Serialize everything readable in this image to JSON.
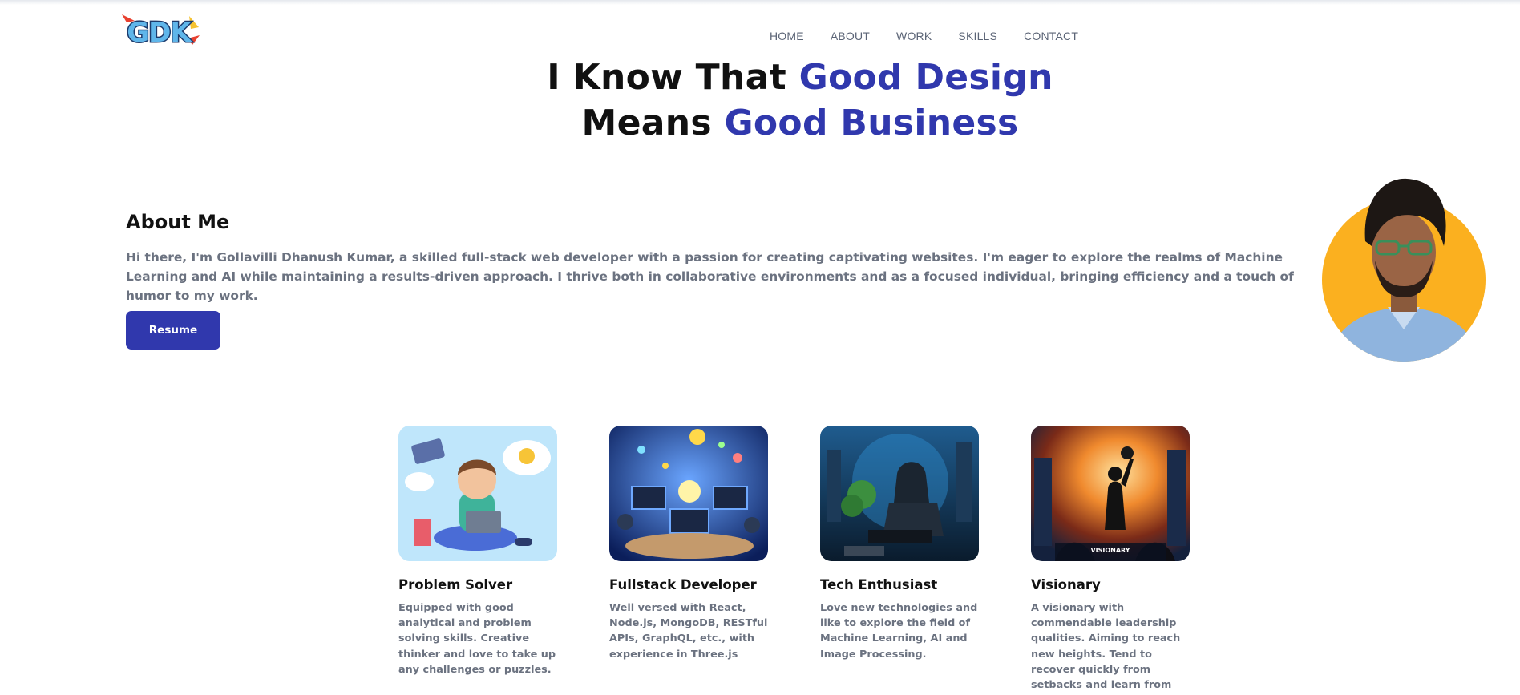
{
  "brand": {
    "logo_text": "GDK"
  },
  "nav": {
    "items": [
      {
        "label": "HOME"
      },
      {
        "label": "ABOUT"
      },
      {
        "label": "WORK"
      },
      {
        "label": "SKILLS"
      },
      {
        "label": "CONTACT"
      }
    ]
  },
  "hero": {
    "line1_plain": "I Know That ",
    "line1_accent": "Good Design",
    "line2_plain": "Means ",
    "line2_accent": "Good Business",
    "accent_color": "#3038ad"
  },
  "about": {
    "title": "About Me",
    "text": "Hi there, I'm Gollavilli Dhanush Kumar, a skilled full-stack web developer with a passion for creating captivating websites. I'm eager to explore the realms of Machine Learning and AI while maintaining a results-driven approach. I thrive both in collaborative environments and as a focused individual, bringing efficiency and a touch of humor to my work.",
    "resume_label": "Resume"
  },
  "cards": [
    {
      "title": "Problem Solver",
      "desc": "Equipped with good analytical and problem solving skills. Creative thinker and love to take up any challenges or puzzles."
    },
    {
      "title": "Fullstack Developer",
      "desc": "Well versed with React, Node.js, MongoDB, RESTful APIs, GraphQL, etc., with experience in Three.js"
    },
    {
      "title": "Tech Enthusiast",
      "desc": "Love new technologies and like to explore the field of Machine Learning, AI and Image Processing."
    },
    {
      "title": "Visionary",
      "desc": "A visionary with commendable leadership qualities. Aiming to reach new heights. Tend to recover quickly from setbacks and learn from failures.",
      "image_caption": "VISIONARY"
    }
  ],
  "colors": {
    "primary": "#3038ad",
    "text_muted": "#6b7280",
    "avatar_bg": "#fbb01f"
  }
}
